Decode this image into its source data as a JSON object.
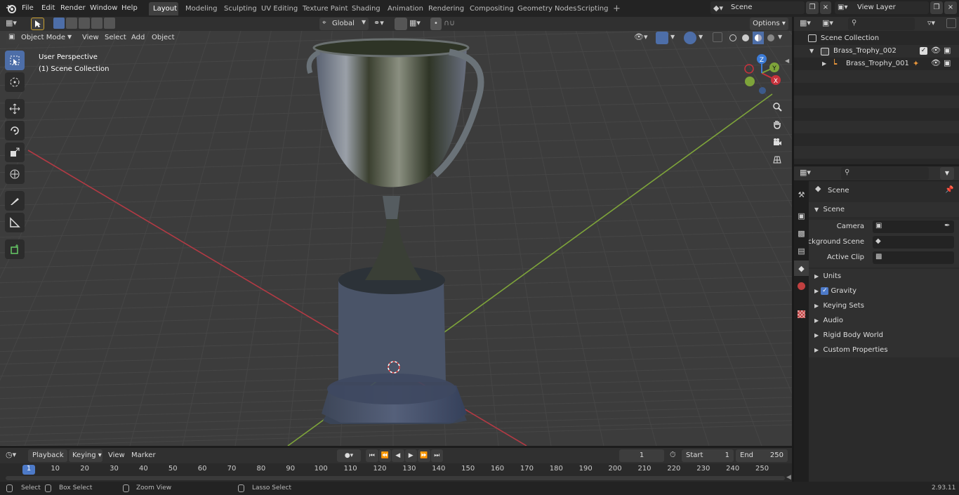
{
  "topbar": {
    "menus": [
      "File",
      "Edit",
      "Render",
      "Window",
      "Help"
    ],
    "workspaces": [
      "Layout",
      "Modeling",
      "Sculpting",
      "UV Editing",
      "Texture Paint",
      "Shading",
      "Animation",
      "Rendering",
      "Compositing",
      "Geometry Nodes",
      "Scripting"
    ],
    "active_workspace": "Layout",
    "add_tab": "+",
    "scene": "Scene",
    "view_layer": "View Layer"
  },
  "viewport_header": {
    "mode": "Object Mode",
    "menus": [
      "View",
      "Select",
      "Add",
      "Object"
    ],
    "transform_orientation": "Global",
    "options": "Options"
  },
  "viewport": {
    "overlay_line1": "User Perspective",
    "overlay_line2": "(1) Scene Collection",
    "axis_x": "X",
    "axis_y": "Y",
    "axis_z": "Z",
    "colors": {
      "x_axis": "#c8323c",
      "y_axis": "#7ea43a",
      "z_axis": "#3c7bd6",
      "grid": "#4a4a4a",
      "bg": "#3c3c3c"
    }
  },
  "outliner": {
    "root": "Scene Collection",
    "items": [
      {
        "label": "Brass_Trophy_002"
      },
      {
        "label": "Brass_Trophy_001"
      }
    ]
  },
  "properties": {
    "context": "Scene",
    "panel_title": "Scene",
    "fields": [
      {
        "label": "Camera",
        "value": ""
      },
      {
        "label": "Background Scene",
        "value": ""
      },
      {
        "label": "Active Clip",
        "value": ""
      }
    ],
    "sections": [
      "Units",
      "Gravity",
      "Keying Sets",
      "Audio",
      "Rigid Body World",
      "Custom Properties"
    ],
    "gravity_checked": true
  },
  "timeline": {
    "menus": [
      "Playback",
      "Keying",
      "View",
      "Marker"
    ],
    "current_frame": "1",
    "start_label": "Start",
    "start_value": "1",
    "end_label": "End",
    "end_value": "250",
    "ticks": [
      "1",
      "10",
      "20",
      "30",
      "40",
      "50",
      "60",
      "70",
      "80",
      "90",
      "100",
      "110",
      "120",
      "130",
      "140",
      "150",
      "160",
      "170",
      "180",
      "190",
      "200",
      "210",
      "220",
      "230",
      "240",
      "250"
    ]
  },
  "status_bar": {
    "items": [
      "Select",
      "Box Select",
      "Zoom View",
      "Lasso Select"
    ],
    "version": "2.93.11"
  }
}
